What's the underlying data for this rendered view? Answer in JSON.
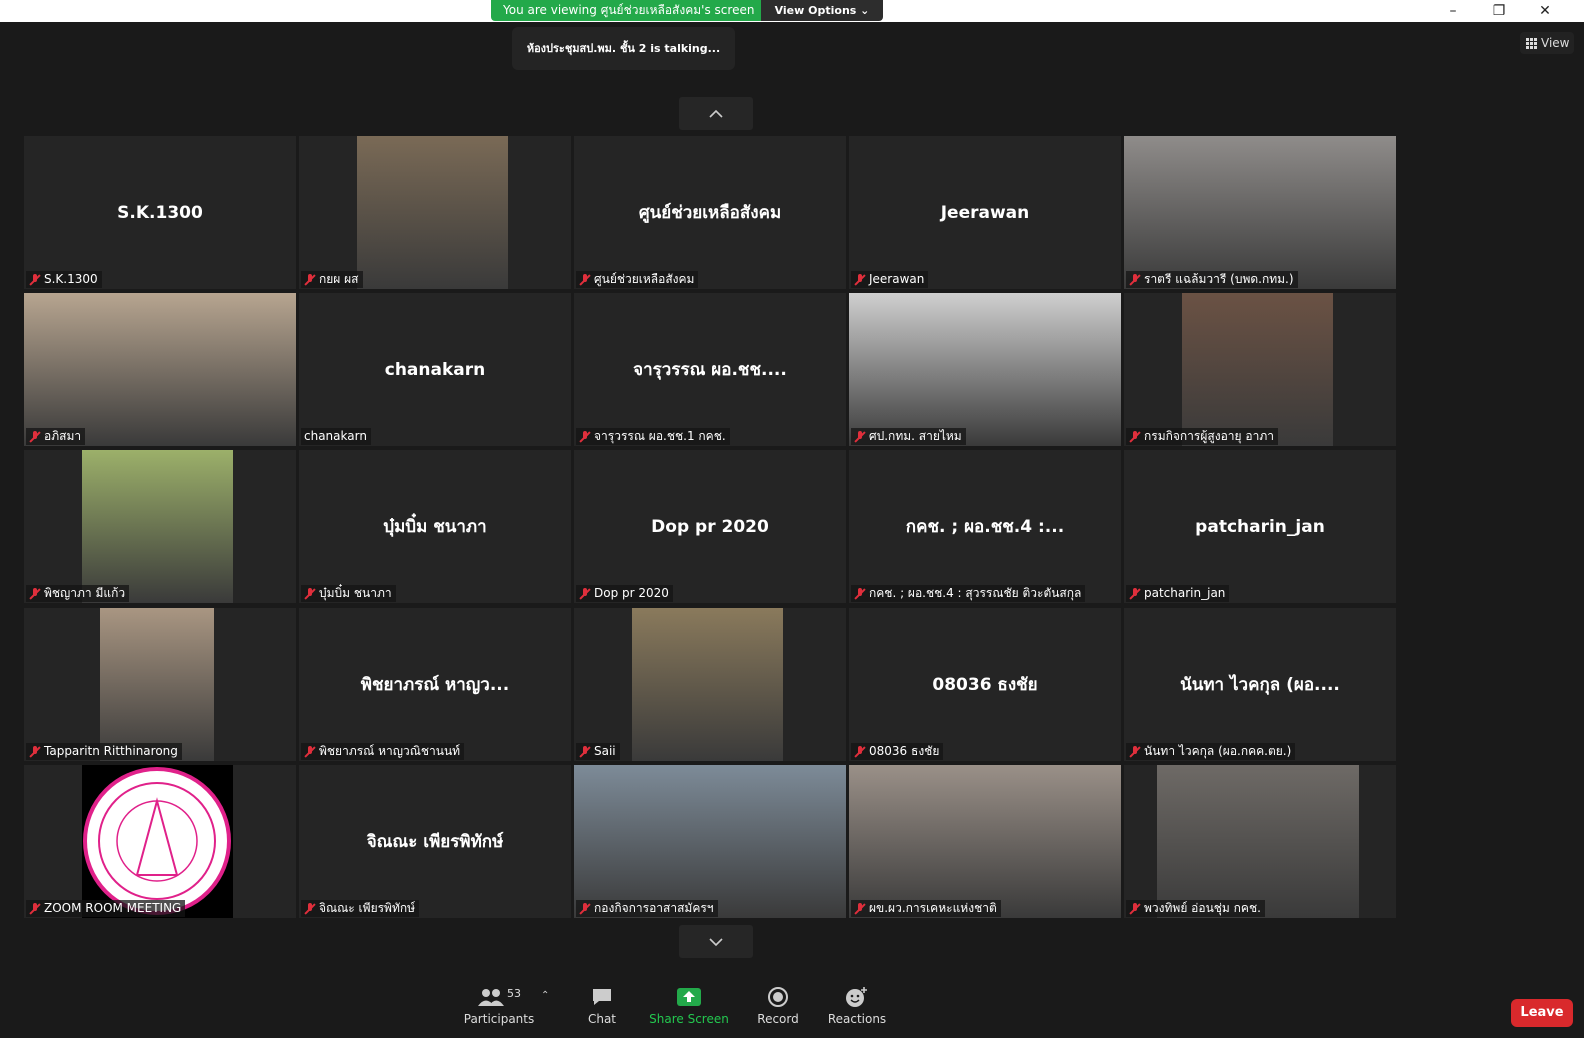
{
  "share_banner": {
    "viewing_text": "You are viewing ศูนย์ช่วยเหลือสังคม's screen",
    "view_options": "View Options"
  },
  "talking_popup": "ห้องประชุมสป.พม. ชั้น 2 is  talking...",
  "view_button": "View",
  "tiles": [
    {
      "big": "S.K.1300",
      "label": "S.K.1300",
      "muted": true
    },
    {
      "big": "",
      "label": "กยผ ผส",
      "muted": true,
      "photo_bg": "#7a6a56"
    },
    {
      "big": "ศูนย์ช่วยเหลือสังคม",
      "label": "ศูนย์ช่วยเหลือสังคม",
      "muted": true
    },
    {
      "big": "Jeerawan",
      "label": "Jeerawan",
      "muted": true
    },
    {
      "big": "",
      "label": "ราตรี แฉล้มวารี (บพด.กทม.)",
      "muted": true,
      "photo_bg": "#8f8c8a"
    },
    {
      "big": "",
      "label": "อภิสมา",
      "muted": true,
      "photo_bg": "#b7a590"
    },
    {
      "big": "chanakarn",
      "label": "chanakarn",
      "muted": false
    },
    {
      "big": "จารุวรรณ  ผอ.ชช....",
      "label": "จารุวรรณ  ผอ.ชช.1 กคช.",
      "muted": true
    },
    {
      "big": "",
      "label": "ศป.กทม. สายไหม",
      "muted": true,
      "photo_bg": "#cfcfcf"
    },
    {
      "big": "",
      "label": "กรมกิจการผู้สูงอายุ อาภา",
      "muted": true,
      "photo_bg": "#6b5244"
    },
    {
      "big": "",
      "label": "พิชญาภา มีแก้ว",
      "muted": true,
      "photo_bg": "#9cb06a"
    },
    {
      "big": "บุ๋มบิ๋ม ชนาภา",
      "label": "บุ๋มบิ๋ม ชนาภา",
      "muted": true
    },
    {
      "big": "Dop pr 2020",
      "label": "Dop pr 2020",
      "muted": true
    },
    {
      "big": "กคช. ; ผอ.ชช.4 :...",
      "label": "กคช. ; ผอ.ชช.4 : สุวรรณชัย ติวะตันสกุล",
      "muted": true
    },
    {
      "big": "patcharin_jan",
      "label": "patcharin_jan",
      "muted": true
    },
    {
      "big": "",
      "label": "Tapparitn  Ritthinarong",
      "muted": true,
      "photo_bg": "#a99682"
    },
    {
      "big": "พิชยาภรณ์ หาญว...",
      "label": "พิชยาภรณ์ หาญวณิชานนท์",
      "muted": true
    },
    {
      "big": "",
      "label": "Saii",
      "muted": true,
      "photo_bg": "#8a7a5c"
    },
    {
      "big": "08036 ธงชัย",
      "label": "08036 ธงชัย",
      "muted": true
    },
    {
      "big": "นันทา ไวคกุล (ผอ....",
      "label": "นันทา ไวคกุล (ผอ.กคค.ตย.)",
      "muted": true
    },
    {
      "big": "",
      "label": "ZOOM ROOM MEETING",
      "muted": true,
      "photo_bg": "#000000"
    },
    {
      "big": "จิณณะ เพียรพิทักษ์",
      "label": "จิณณะ เพียรพิทักษ์",
      "muted": true
    },
    {
      "big": "",
      "label": "กองกิจการอาสาสมัครฯ",
      "muted": true,
      "photo_bg": "#7d8b98"
    },
    {
      "big": "",
      "label": "ผข.ผว.การเคหะแห่งชาติ",
      "muted": true,
      "photo_bg": "#9a9088"
    },
    {
      "big": "",
      "label": "พวงทิพย์ อ่อนชุ่ม  กคช.",
      "muted": true,
      "photo_bg": "#6e6a66"
    }
  ],
  "toolbar": {
    "participants_label": "Participants",
    "participants_count": "53",
    "chat_label": "Chat",
    "share_label": "Share Screen",
    "record_label": "Record",
    "reactions_label": "Reactions",
    "leave_label": "Leave"
  },
  "colors": {
    "share_green": "#23a94a",
    "muted_red": "#e02f3c",
    "leave_red": "#d9292c"
  }
}
